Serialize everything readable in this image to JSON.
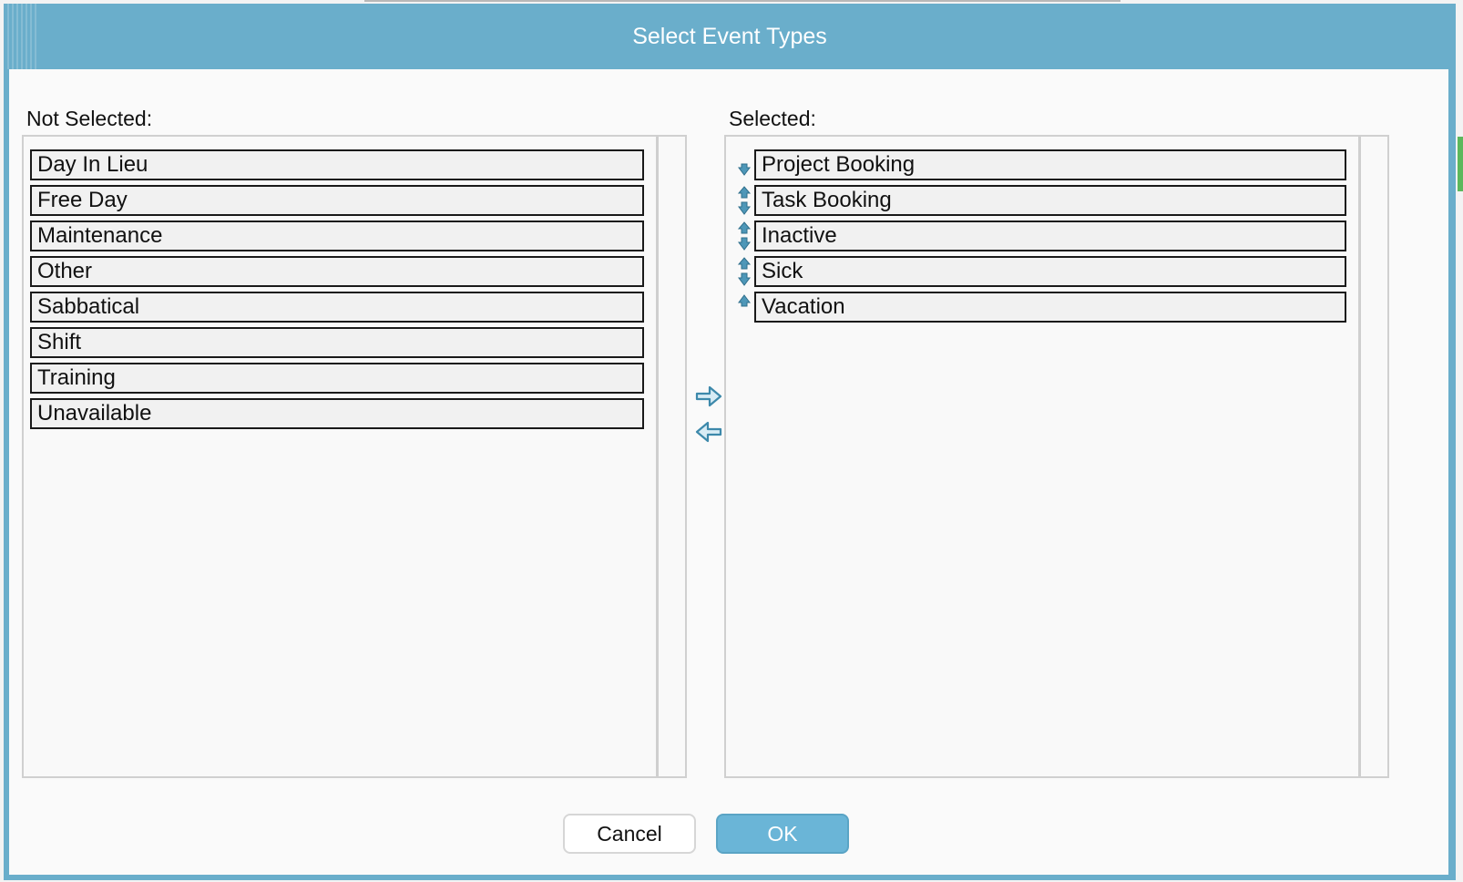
{
  "dialog": {
    "title": "Select Event Types"
  },
  "not_selected": {
    "label": "Not Selected:",
    "items": [
      {
        "label": "Day In Lieu"
      },
      {
        "label": "Free Day"
      },
      {
        "label": "Maintenance"
      },
      {
        "label": "Other"
      },
      {
        "label": "Sabbatical"
      },
      {
        "label": "Shift"
      },
      {
        "label": "Training"
      },
      {
        "label": "Unavailable"
      }
    ]
  },
  "selected": {
    "label": "Selected:",
    "items": [
      {
        "label": "Project Booking",
        "reorder": "move-down"
      },
      {
        "label": "Task Booking",
        "reorder": "move-up-down"
      },
      {
        "label": "Inactive",
        "reorder": "move-up-down"
      },
      {
        "label": "Sick",
        "reorder": "move-up-down"
      },
      {
        "label": "Vacation",
        "reorder": "move-up"
      }
    ]
  },
  "transfer": {
    "add_icon": "arrow-right-icon",
    "remove_icon": "arrow-left-icon"
  },
  "buttons": {
    "cancel": "Cancel",
    "ok": "OK"
  },
  "colors": {
    "titlebar": "#6aaecb",
    "ok_button": "#6ab5d7",
    "arrow": "#4e97b8"
  }
}
